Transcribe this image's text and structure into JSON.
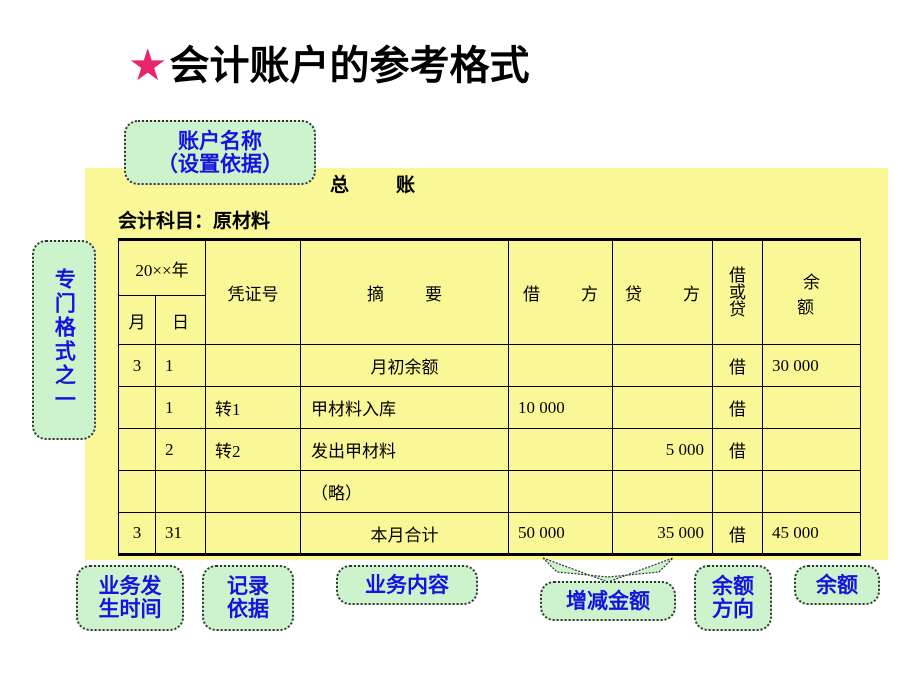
{
  "slide": {
    "title": "会计账户的参考格式",
    "star_glyph": "★",
    "star_color": "#e8256c",
    "background": "#ffffff"
  },
  "ledger": {
    "panel_color": "#faf797",
    "heading": "总　账",
    "subject_line": "会计科目：原材料",
    "columns": {
      "year": "20××年",
      "month": "月",
      "day": "日",
      "voucher_no": "凭证号",
      "summary": "摘　要",
      "debit": "借　方",
      "credit": "贷　方",
      "dc_direction": "借或贷",
      "balance": "余　额"
    },
    "rows": [
      {
        "month": "3",
        "day": "1",
        "voucher_no": "",
        "summary": "月初余额",
        "summary_align": "center",
        "debit": "",
        "credit": "",
        "dc_direction": "借",
        "balance": "30 000"
      },
      {
        "month": "",
        "day": "1",
        "voucher_no": "转1",
        "summary": "甲材料入库",
        "summary_align": "left",
        "debit": "10 000",
        "credit": "",
        "dc_direction": "借",
        "balance": ""
      },
      {
        "month": "",
        "day": "2",
        "voucher_no": "转2",
        "summary": "发出甲材料",
        "summary_align": "left",
        "debit": "",
        "credit": "5 000",
        "dc_direction": "借",
        "balance": ""
      },
      {
        "month": "",
        "day": "",
        "voucher_no": "",
        "summary": "（略）",
        "summary_align": "left",
        "debit": "",
        "credit": "",
        "dc_direction": "",
        "balance": ""
      },
      {
        "month": "3",
        "day": "31",
        "voucher_no": "",
        "summary": "本月合计",
        "summary_align": "center",
        "debit": "50 000",
        "credit": "35 000",
        "dc_direction": "借",
        "balance": "45 000"
      }
    ]
  },
  "callouts": {
    "box_fill": "#ccf3cc",
    "text_color": "#1414e0",
    "account_name": "账户名称\n（设置依据）",
    "account_name_line1": "账户名称",
    "account_name_line2": "（设置依据）",
    "special_format": "专门格式之一",
    "business_time_line1": "业务发",
    "business_time_line2": "生时间",
    "record_basis_line1": "记录",
    "record_basis_line2": "依据",
    "business_content": "业务内容",
    "change_amount": "增减金额",
    "balance_direction_line1": "余额",
    "balance_direction_line2": "方向",
    "balance": "余额"
  }
}
